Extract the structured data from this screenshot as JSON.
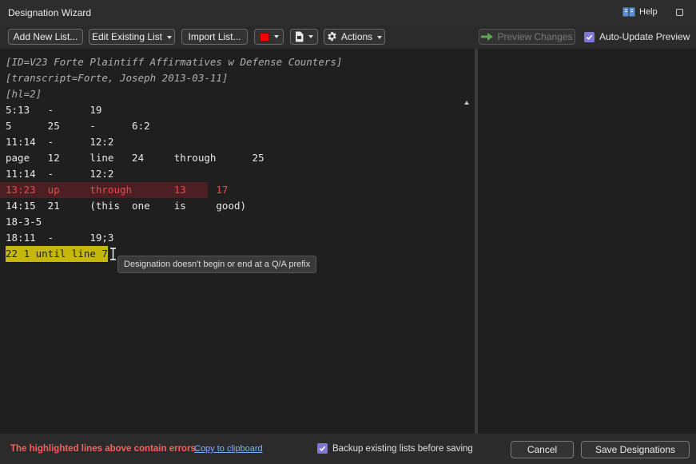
{
  "window": {
    "title": "Designation Wizard",
    "help_label": "Help"
  },
  "toolbar": {
    "add_new_list": "Add New List...",
    "edit_existing_list": "Edit Existing List",
    "import_list": "Import List...",
    "highlight_color": "#ff0000",
    "actions": "Actions",
    "preview_changes": "Preview Changes",
    "auto_update_preview": "Auto-Update Preview",
    "auto_update_checked": true
  },
  "editor": {
    "lines": [
      {
        "text": "[ID=V23 Forte Plaintiff Affirmatives w Defense Counters]",
        "style": "comment"
      },
      {
        "text": "[transcript=Forte, Joseph 2013-03-11]",
        "style": "comment"
      },
      {
        "text": "[hl=2]",
        "style": "comment"
      },
      {
        "text": "5:13   -      19",
        "style": "normal"
      },
      {
        "text": "5      25     -      6:2",
        "style": "normal"
      },
      {
        "text": "11:14  -      12:2",
        "style": "normal"
      },
      {
        "text": "page   12     line   24     through      25",
        "style": "normal"
      },
      {
        "text": "11:14  -      12:2",
        "style": "normal"
      },
      {
        "text": "13:23  up     through       13     17",
        "style": "error-red"
      },
      {
        "text": "14:15  21     (this  one    is     good)",
        "style": "normal"
      },
      {
        "text": "18-3-5",
        "style": "normal"
      },
      {
        "text": "18:11  -      19;3",
        "style": "normal"
      },
      {
        "text": "22 1 until line 7",
        "style": "error-yellow"
      }
    ],
    "tooltip": "Designation doesn't begin or end at a Q/A prefix"
  },
  "footer": {
    "error_message": "The highlighted lines above contain errors.",
    "copy_link": "Copy to clipboard",
    "backup_label": "Backup existing lists before saving",
    "backup_checked": true,
    "cancel": "Cancel",
    "save": "Save Designations"
  },
  "colors": {
    "accent": "#7f78d8",
    "error_text": "#ff5f5f",
    "error_line_bg": "#4b1f24",
    "warning_line_bg": "#c5b80a"
  }
}
